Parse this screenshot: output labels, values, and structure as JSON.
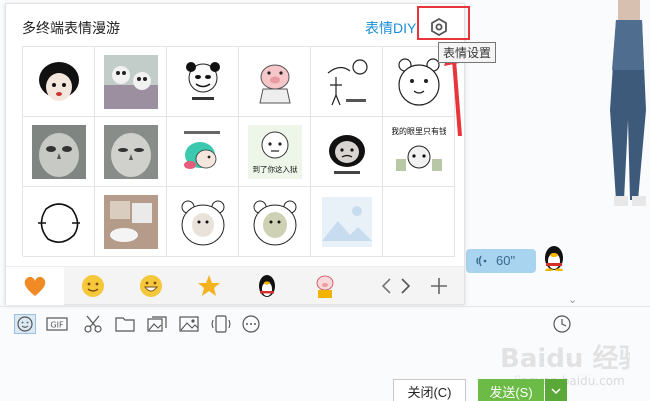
{
  "emoji_panel": {
    "title": "多终端表情漫游",
    "diy_link": "表情DIY",
    "settings_tooltip": "表情设置",
    "grid": [
      [
        "stickman-face",
        "panda-photo",
        "panda-meme",
        "pink-pig",
        "stick-figure",
        "white-bear"
      ],
      [
        "owl-photo",
        "owl-photo-2",
        "teal-hair-cartoon",
        "bear-meme",
        "panda-meme-2",
        "panda-money"
      ],
      [
        "outline-blob",
        "photo-collage",
        "bear-meme-3",
        "bear-meme-4",
        "image-placeholder",
        ""
      ]
    ],
    "grid_captions": {
      "panda_money": "我的眼里只有钱",
      "bear_meme": "到了你这入狱"
    },
    "tabs": [
      "heart-icon",
      "smile-icon",
      "grin-icon",
      "star-icon",
      "penguin-icon",
      "pig-icon"
    ]
  },
  "chat": {
    "voice_duration": "60\""
  },
  "toolbar": {
    "icons": [
      "emoji-icon",
      "gif-icon",
      "scissors-icon",
      "folder-icon",
      "photo-album-icon",
      "image-icon",
      "shake-icon",
      "more-icon",
      "history-icon"
    ],
    "gif_label": "GIF"
  },
  "footer": {
    "close_label": "关闭(C)",
    "send_label": "发送(S)"
  },
  "watermark": {
    "text": "Baidu 经验",
    "url": "jingyan.baidu.com"
  },
  "colors": {
    "accent_blue": "#1a8fd6",
    "highlight_red": "#e8343a",
    "send_green": "#6bbb46",
    "voice_bubble": "#a9d4f0"
  }
}
